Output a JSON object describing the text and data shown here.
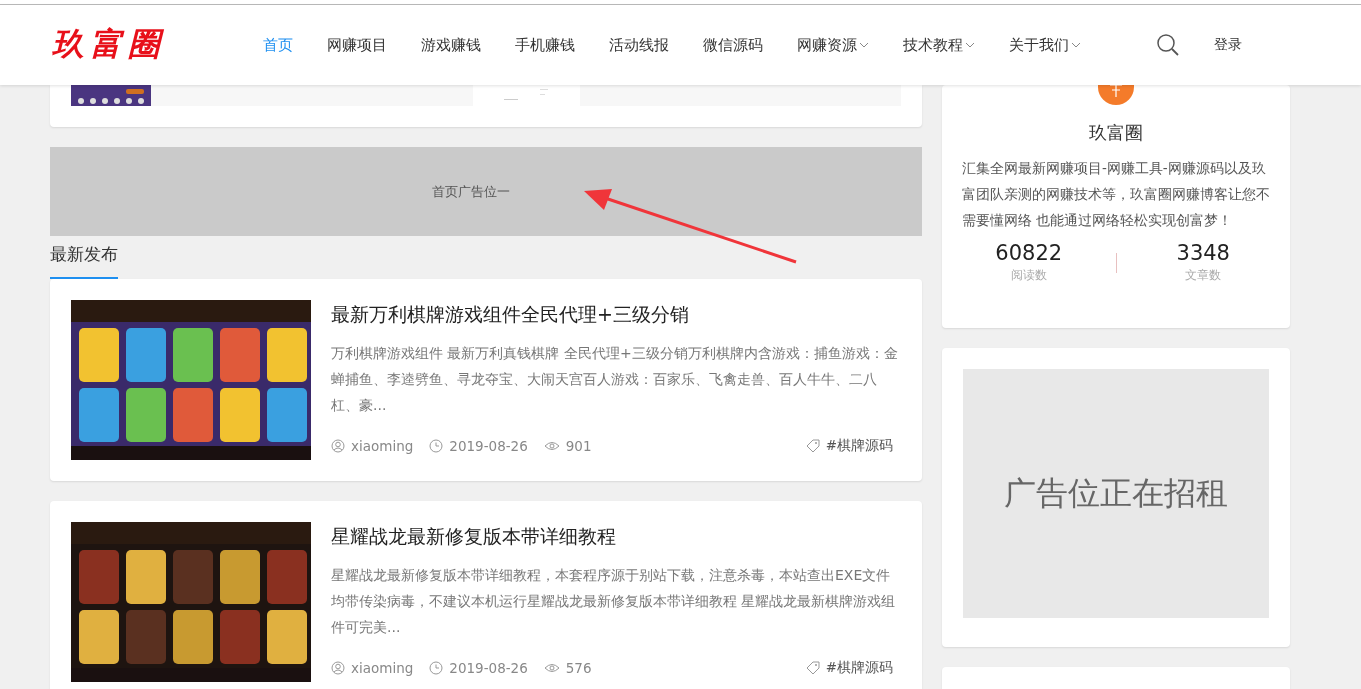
{
  "header": {
    "logo": "玖富圈",
    "nav": [
      {
        "label": "首页",
        "selected": true,
        "dropdown": false
      },
      {
        "label": "网赚项目",
        "selected": false,
        "dropdown": false
      },
      {
        "label": "游戏赚钱",
        "selected": false,
        "dropdown": false
      },
      {
        "label": "手机赚钱",
        "selected": false,
        "dropdown": false
      },
      {
        "label": "活动线报",
        "selected": false,
        "dropdown": false
      },
      {
        "label": "微信源码",
        "selected": false,
        "dropdown": false
      },
      {
        "label": "网赚资源",
        "selected": false,
        "dropdown": true
      },
      {
        "label": "技术教程",
        "selected": false,
        "dropdown": true
      },
      {
        "label": "关于我们",
        "selected": false,
        "dropdown": true
      }
    ],
    "login": "登录"
  },
  "ad_banner": "首页广告位一",
  "section_title": "最新发布",
  "posts": [
    {
      "title": "最新万利棋牌游戏组件全民代理+三级分销",
      "excerpt": "万利棋牌游戏组件 最新万利真钱棋牌 全民代理+三级分销万利棋牌内含游戏：捕鱼游戏：金蝉捕鱼、李逵劈鱼、寻龙夺宝、大闹天宫百人游戏：百家乐、飞禽走兽、百人牛牛、二八杠、豪...",
      "author": "xiaoming",
      "date": "2019-08-26",
      "views": "901",
      "tag": "#棋牌源码"
    },
    {
      "title": "星耀战龙最新修复版本带详细教程",
      "excerpt": "星耀战龙最新修复版本带详细教程，本套程序源于别站下载，注意杀毒，本站查出EXE文件均带传染病毒，不建议本机运行星耀战龙最新修复版本带详细教程 星耀战龙最新棋牌游戏组件可完美...",
      "author": "xiaoming",
      "date": "2019-08-26",
      "views": "576",
      "tag": "#棋牌源码"
    }
  ],
  "profile": {
    "name": "玖富圈",
    "description": "汇集全网最新网赚项目-网赚工具-网赚源码以及玖富团队亲测的网赚技术等，玖富圈网赚博客让您不需要懂网络 也能通过网络轻松实现创富梦！",
    "stats": [
      {
        "value": "60822",
        "label": "阅读数"
      },
      {
        "value": "3348",
        "label": "文章数"
      }
    ]
  },
  "sidebar_ad": "广告位正在招租"
}
